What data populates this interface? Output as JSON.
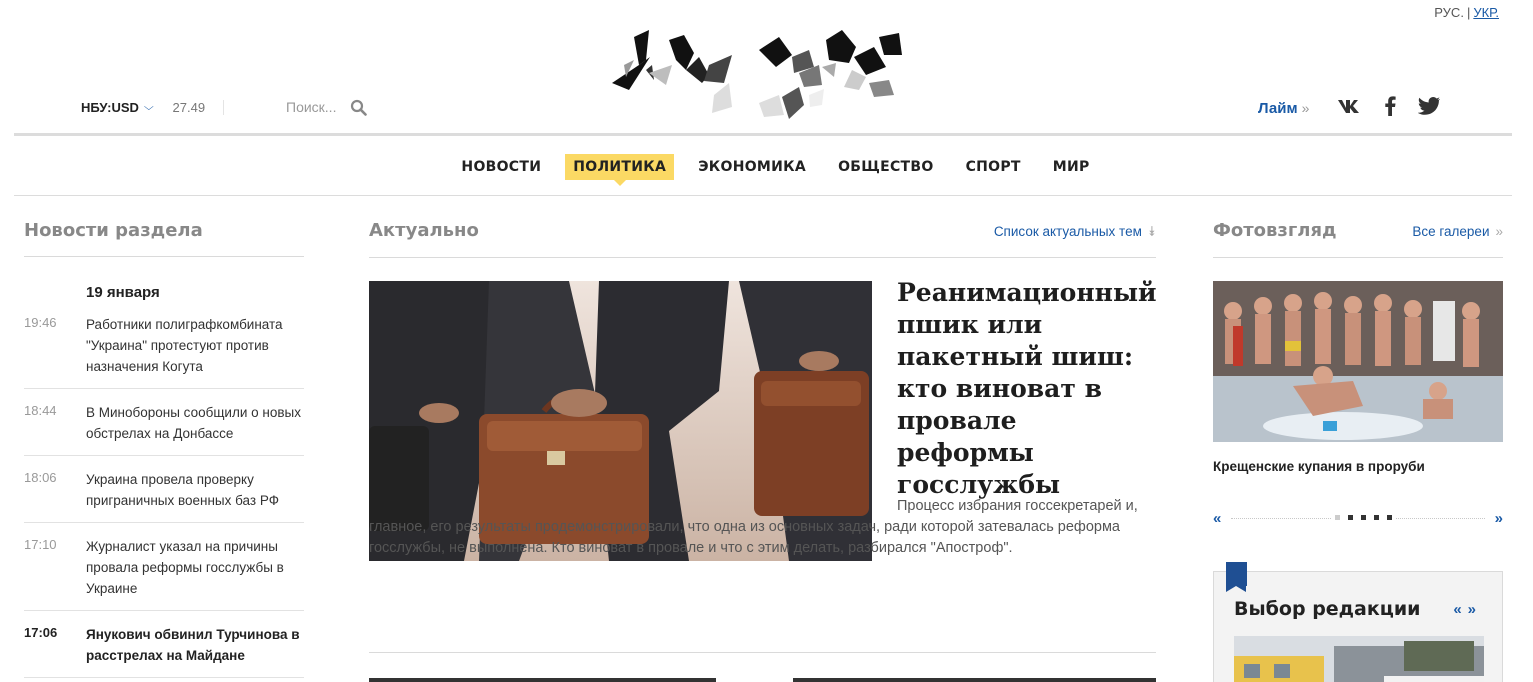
{
  "header": {
    "lang": {
      "ru": "РУС.",
      "sep": "|",
      "uk": "УКР."
    },
    "rate": {
      "label": "НБУ:USD",
      "value": "27.49"
    },
    "search": {
      "placeholder": "Поиск..."
    },
    "laim": {
      "label": "Лайм",
      "arrow": "»"
    },
    "social": [
      "vk-icon",
      "facebook-icon",
      "twitter-icon"
    ]
  },
  "nav": {
    "items": [
      {
        "label": "НОВОСТИ",
        "active": false
      },
      {
        "label": "ПОЛИТИКА",
        "active": true
      },
      {
        "label": "ЭКОНОМИКА",
        "active": false
      },
      {
        "label": "ОБЩЕСТВО",
        "active": false
      },
      {
        "label": "СПОРТ",
        "active": false
      },
      {
        "label": "МИР",
        "active": false
      }
    ]
  },
  "left": {
    "title": "Новости раздела",
    "date": "19 января",
    "news": [
      {
        "time": "19:46",
        "text": "Работники полиграфкомбината \"Украина\" протестуют против назначения Когута",
        "bold": false
      },
      {
        "time": "18:44",
        "text": "В Минобороны сообщили о новых обстрелах на Донбассе",
        "bold": false
      },
      {
        "time": "18:06",
        "text": "Украина провела проверку приграничных военных баз РФ",
        "bold": false
      },
      {
        "time": "17:10",
        "text": "Журналист указал на причины провала реформы госслужбы в Украине",
        "bold": false
      },
      {
        "time": "17:06",
        "text": "Янукович обвинил Турчинова в расстрелах на Майдане",
        "bold": true
      }
    ]
  },
  "middle": {
    "title": "Актуально",
    "more": "Список актуальных тем",
    "more_arrow": "»",
    "feature": {
      "title": "Реанимационный пшик или пакетный шиш: кто виноват в провале реформы госслужбы",
      "lead": "Процесс избрания госсекретарей и, главное, его результаты продемонстрировали, что одна из основных задач, ради которой затевалась реформа госслужбы, не выполнена. Кто виноват в провале и что с этим делать, разбирался \"Апостроф\"."
    }
  },
  "right": {
    "title": "Фотовзгляд",
    "more": "Все галереи",
    "more_arrow": "»",
    "caption": "Крещенские купания в проруби",
    "prev": "«",
    "next": "»",
    "editors": {
      "title": "Выбор редакции",
      "prev": "«",
      "next": "»"
    }
  },
  "colors": {
    "accent": "#1a5aa6",
    "nav_active": "#fbd964",
    "badge": "#1f4f93"
  }
}
